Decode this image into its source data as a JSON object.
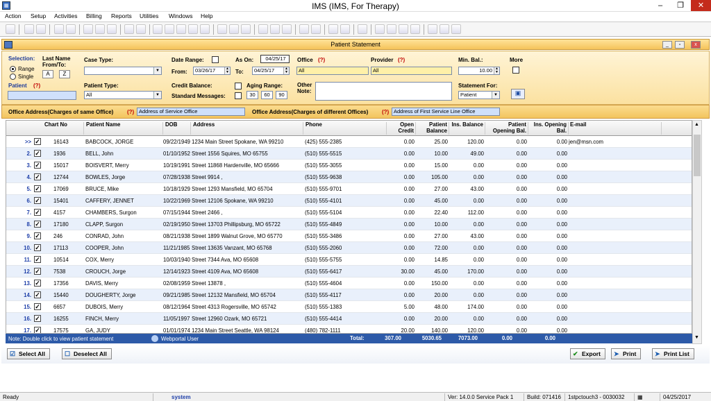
{
  "window": {
    "title": "IMS (IMS, For Therapy)"
  },
  "menu": [
    "Action",
    "Setup",
    "Activities",
    "Billing",
    "Reports",
    "Utilities",
    "Windows",
    "Help"
  ],
  "form": {
    "title": "Patient Statement"
  },
  "filter": {
    "selection_label": "Selection:",
    "range_label": "Range",
    "single_label": "Single",
    "last_name_label": "Last Name",
    "from_to_label": "From/To:",
    "a_btn": "A",
    "z_btn": "Z",
    "patient_label": "Patient",
    "q": "(?)",
    "case_type_label": "Case Type:",
    "patient_type_label": "Patient Type:",
    "patient_type_value": "All",
    "date_range_label": "Date Range:",
    "as_on_label": "As On:",
    "as_on_value": "04/25/17",
    "from_label": "From:",
    "from_value": "03/26/17",
    "to_label": "To:",
    "to_value": "04/25/17",
    "credit_balance_label": "Credit Balance:",
    "aging_range_label": "Aging Range:",
    "standard_messages_label": "Standard Messages:",
    "aging": [
      "30",
      "60",
      "90"
    ],
    "office_label": "Office",
    "office_value": "All",
    "provider_label": "Provider",
    "provider_value": "All",
    "other_note_label1": "Other",
    "other_note_label2": "Note:",
    "min_bal_label": "Min. Bal.:",
    "min_bal_value": "10.00",
    "more_label": "More",
    "statement_for_label": "Statement For:",
    "statement_for_value": "Patient"
  },
  "office_bar": {
    "same_label": "Office Address(Charges of same Office)",
    "same_q": "(?)",
    "same_value": "Address of Service Office",
    "diff_label": "Office Address(Charges of different Offices)",
    "diff_q": "(?)",
    "diff_value": "Address of First Service Line Office"
  },
  "grid": {
    "headers": {
      "chart_no": "Chart No",
      "patient_name": "Patient Name",
      "dob": "DOB",
      "address": "Address",
      "phone": "Phone",
      "open_credit": "Open Credit",
      "patient_balance": "Patient Balance",
      "ins_balance": "Ins. Balance",
      "patient_opening": "Patient Opening Bal.",
      "ins_opening": "Ins. Opening Bal.",
      "email": "E-mail"
    },
    "rows": [
      {
        "n": ">>",
        "chart": "16143",
        "name": "BABCOCK, JORGE",
        "dob": "09/22/1949",
        "addr": "1234 Main Street Spokane, WA 99210",
        "phone": "(425) 555-2385",
        "oc": "0.00",
        "pb": "25.00",
        "ib": "120.00",
        "po": "0.00",
        "io": "0.00",
        "email": "jen@msn.com"
      },
      {
        "n": "2.",
        "chart": "1936",
        "name": "BELL, John",
        "dob": "01/10/1952",
        "addr": "Street 1556 Squires, MO 65755",
        "phone": "(510) 555-5515",
        "oc": "0.00",
        "pb": "10.00",
        "ib": "49.00",
        "po": "0.00",
        "io": "0.00",
        "email": ""
      },
      {
        "n": "3.",
        "chart": "15017",
        "name": "BOISVERT, Merry",
        "dob": "10/19/1991",
        "addr": "Street 11868 Hardenville, MO 65666",
        "phone": "(510) 555-3055",
        "oc": "0.00",
        "pb": "15.00",
        "ib": "0.00",
        "po": "0.00",
        "io": "0.00",
        "email": ""
      },
      {
        "n": "4.",
        "chart": "12744",
        "name": "BOWLES, Jorge",
        "dob": "07/28/1938",
        "addr": "Street 9914 ,",
        "phone": "(510) 555-9638",
        "oc": "0.00",
        "pb": "105.00",
        "ib": "0.00",
        "po": "0.00",
        "io": "0.00",
        "email": ""
      },
      {
        "n": "5.",
        "chart": "17069",
        "name": "BRUCE, Mike",
        "dob": "10/18/1929",
        "addr": "Street 1293 Mansfield, MO 65704",
        "phone": "(510) 555-9701",
        "oc": "0.00",
        "pb": "27.00",
        "ib": "43.00",
        "po": "0.00",
        "io": "0.00",
        "email": ""
      },
      {
        "n": "6.",
        "chart": "15401",
        "name": "CAFFERY, JENNET",
        "dob": "10/22/1969",
        "addr": "Street 12106 Spokane, WA 99210",
        "phone": "(510) 555-4101",
        "oc": "0.00",
        "pb": "45.00",
        "ib": "0.00",
        "po": "0.00",
        "io": "0.00",
        "email": ""
      },
      {
        "n": "7.",
        "chart": "4157",
        "name": "CHAMBERS, Surgon",
        "dob": "07/15/1944",
        "addr": "Street 2466 ,",
        "phone": "(510) 555-5104",
        "oc": "0.00",
        "pb": "22.40",
        "ib": "112.00",
        "po": "0.00",
        "io": "0.00",
        "email": ""
      },
      {
        "n": "8.",
        "chart": "17180",
        "name": "CLAPP, Surgon",
        "dob": "02/19/1950",
        "addr": "Street 13703 Phillipsburg, MO 65722",
        "phone": "(510) 555-4849",
        "oc": "0.00",
        "pb": "10.00",
        "ib": "0.00",
        "po": "0.00",
        "io": "0.00",
        "email": ""
      },
      {
        "n": "9.",
        "chart": "246",
        "name": "CONRAD, John",
        "dob": "08/21/1938",
        "addr": "Street 1899 Walnut Grove, MO 65770",
        "phone": "(510) 555-3486",
        "oc": "0.00",
        "pb": "27.00",
        "ib": "43.00",
        "po": "0.00",
        "io": "0.00",
        "email": ""
      },
      {
        "n": "10.",
        "chart": "17113",
        "name": "COOPER, John",
        "dob": "11/21/1985",
        "addr": "Street 13635 Vanzant, MO 65768",
        "phone": "(510) 555-2060",
        "oc": "0.00",
        "pb": "72.00",
        "ib": "0.00",
        "po": "0.00",
        "io": "0.00",
        "email": ""
      },
      {
        "n": "11.",
        "chart": "10514",
        "name": "COX, Merry",
        "dob": "10/03/1940",
        "addr": "Street 7344 Ava, MO 65608",
        "phone": "(510) 555-5755",
        "oc": "0.00",
        "pb": "14.85",
        "ib": "0.00",
        "po": "0.00",
        "io": "0.00",
        "email": ""
      },
      {
        "n": "12.",
        "chart": "7538",
        "name": "CROUCH, Jorge",
        "dob": "12/14/1923",
        "addr": "Street 4109 Ava, MO 65608",
        "phone": "(510) 555-6417",
        "oc": "30.00",
        "pb": "45.00",
        "ib": "170.00",
        "po": "0.00",
        "io": "0.00",
        "email": ""
      },
      {
        "n": "13.",
        "chart": "17356",
        "name": "DAVIS, Merry",
        "dob": "02/08/1959",
        "addr": "Street 13878 ,",
        "phone": "(510) 555-4604",
        "oc": "0.00",
        "pb": "150.00",
        "ib": "0.00",
        "po": "0.00",
        "io": "0.00",
        "email": ""
      },
      {
        "n": "14.",
        "chart": "15440",
        "name": "DOUGHERTY, Jorge",
        "dob": "09/21/1985",
        "addr": "Street 12132 Mansfield, MO 65704",
        "phone": "(510) 555-4117",
        "oc": "0.00",
        "pb": "20.00",
        "ib": "0.00",
        "po": "0.00",
        "io": "0.00",
        "email": ""
      },
      {
        "n": "15.",
        "chart": "6657",
        "name": "DUBOIS, Merry",
        "dob": "08/12/1964",
        "addr": "Street 4313 Rogersville, MO 65742",
        "phone": "(510) 555-1383",
        "oc": "5.00",
        "pb": "48.00",
        "ib": "174.00",
        "po": "0.00",
        "io": "0.00",
        "email": ""
      },
      {
        "n": "16.",
        "chart": "16255",
        "name": "FINCH, Merry",
        "dob": "11/05/1997",
        "addr": "Street 12960 Ozark, MO 65721",
        "phone": "(510) 555-4414",
        "oc": "0.00",
        "pb": "20.00",
        "ib": "0.00",
        "po": "0.00",
        "io": "0.00",
        "email": ""
      },
      {
        "n": "17.",
        "chart": "17575",
        "name": "GA, JUDY",
        "dob": "01/01/1974",
        "addr": "1234 Main Street Seattle, WA 98124",
        "phone": "(480) 782-1111",
        "oc": "20.00",
        "pb": "140.00",
        "ib": "120.00",
        "po": "0.00",
        "io": "0.00",
        "email": ""
      }
    ]
  },
  "footer": {
    "note": "Note: Double click to view patient statement",
    "webportal": "Webportal User",
    "total_label": "Total:",
    "oc": "307.00",
    "pb": "5030.65",
    "ib": "7073.00",
    "po": "0.00",
    "io": "0.00"
  },
  "buttons": {
    "select_all": "Select All",
    "deselect_all": "Deselect All",
    "export": "Export",
    "print": "Print",
    "print_list": "Print List"
  },
  "status": {
    "ready": "Ready",
    "user": "system",
    "version": "Ver: 14.0.0 Service Pack 1",
    "build": "Build: 071416",
    "server": "1stpctouch3 - 0030032",
    "date": "04/25/2017"
  }
}
